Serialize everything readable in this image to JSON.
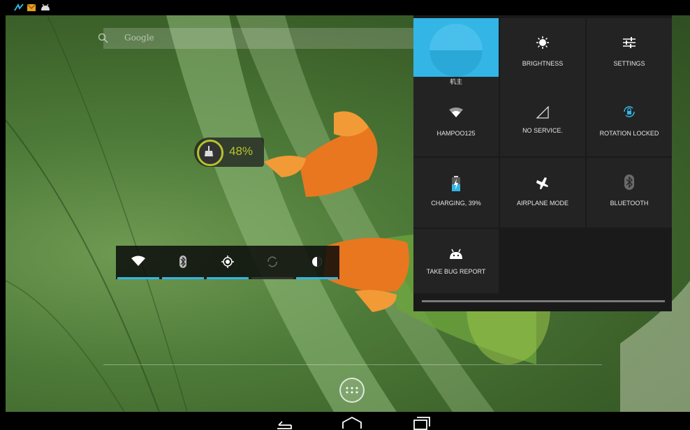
{
  "status_bar": {
    "notification_icons": [
      "leaf-notification-icon",
      "mail-notification-icon",
      "android-notification-icon"
    ]
  },
  "search": {
    "placeholder": "Google"
  },
  "battery_widget": {
    "percent": "48%",
    "accent": "#b5c42a"
  },
  "power_widget": {
    "buttons": [
      {
        "name": "wifi",
        "active": true
      },
      {
        "name": "bluetooth",
        "active": true
      },
      {
        "name": "gps",
        "active": true
      },
      {
        "name": "sync",
        "active": false
      },
      {
        "name": "brightness",
        "active": true
      }
    ],
    "active_color": "#33b5e5"
  },
  "quick_settings": {
    "owner": {
      "label": "机主",
      "accent": "#33b5e5"
    },
    "brightness": {
      "label": "BRIGHTNESS"
    },
    "settings": {
      "label": "SETTINGS"
    },
    "wifi": {
      "label": "HAMPOO125"
    },
    "signal": {
      "label": "NO SERVICE."
    },
    "rotation": {
      "label": "ROTATION LOCKED"
    },
    "battery": {
      "label": "CHARGING, 39%"
    },
    "airplane": {
      "label": "AIRPLANE MODE"
    },
    "bluetooth": {
      "label": "BLUETOOTH"
    },
    "bugreport": {
      "label": "TAKE BUG REPORT"
    }
  },
  "nav_bar": {
    "buttons": [
      "back-icon",
      "home-icon",
      "recents-icon"
    ]
  }
}
